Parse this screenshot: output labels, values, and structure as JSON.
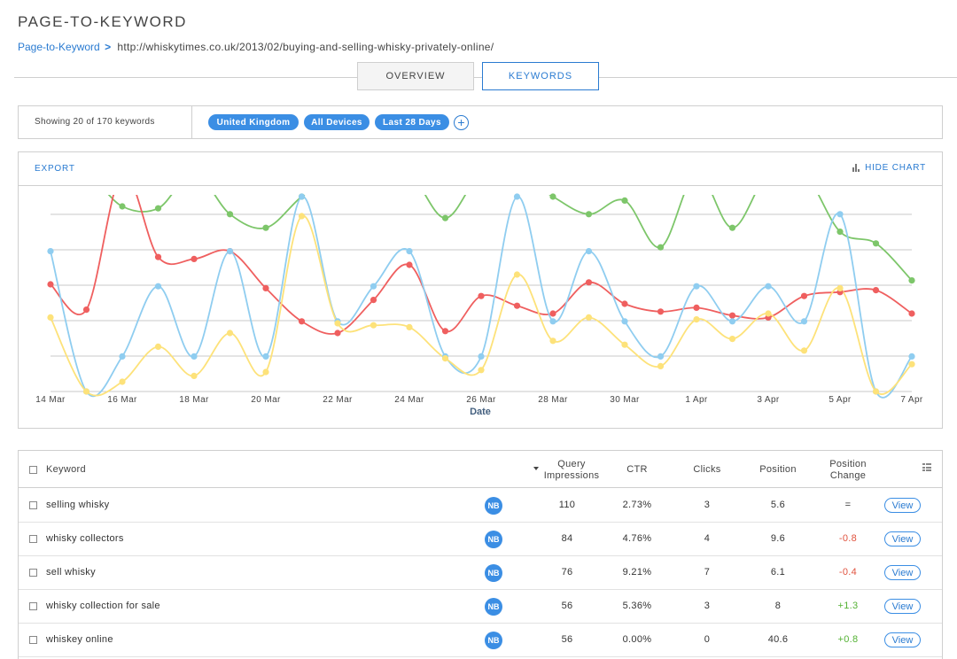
{
  "page": {
    "title": "PAGE-TO-KEYWORD"
  },
  "breadcrumb": {
    "link": "Page-to-Keyword",
    "separator": ">",
    "url": "http://whiskytimes.co.uk/2013/02/buying-and-selling-whisky-privately-online/"
  },
  "tabs": [
    {
      "label": "OVERVIEW",
      "active": false
    },
    {
      "label": "KEYWORDS",
      "active": true
    }
  ],
  "filters": {
    "showing": "Showing 20 of 170 keywords",
    "pills": [
      "United Kingdom",
      "All Devices",
      "Last 28 Days"
    ],
    "add": "+"
  },
  "chart_toolbar": {
    "export": "EXPORT",
    "hide_chart": "HIDE CHART",
    "hide_chart_icon": "bar-chart-icon"
  },
  "chart_data": {
    "type": "line",
    "xlabel": "Date",
    "x_ticks": [
      "14 Mar",
      "16 Mar",
      "18 Mar",
      "20 Mar",
      "22 Mar",
      "24 Mar",
      "26 Mar",
      "28 Mar",
      "30 Mar",
      "1 Apr",
      "3 Apr",
      "5 Apr",
      "7 Apr"
    ],
    "x": [
      "14 Mar",
      "15 Mar",
      "16 Mar",
      "17 Mar",
      "18 Mar",
      "19 Mar",
      "20 Mar",
      "21 Mar",
      "22 Mar",
      "23 Mar",
      "24 Mar",
      "25 Mar",
      "26 Mar",
      "27 Mar",
      "28 Mar",
      "29 Mar",
      "30 Mar",
      "31 Mar",
      "1 Apr",
      "2 Apr",
      "3 Apr",
      "4 Apr",
      "5 Apr",
      "6 Apr",
      "7 Apr"
    ],
    "ylim": [
      0,
      1
    ],
    "grid": true,
    "series": [
      {
        "color": "#7dc66a",
        "values": [
          null,
          null,
          0.95,
          0.94,
          null,
          0.91,
          0.84,
          1.0,
          null,
          null,
          null,
          0.89,
          null,
          null,
          1.0,
          0.91,
          0.98,
          0.74,
          null,
          0.84,
          null,
          null,
          0.82,
          0.76,
          0.57
        ]
      },
      {
        "color": "#ef5f5f",
        "values": [
          0.55,
          0.42,
          null,
          0.69,
          0.68,
          0.72,
          0.53,
          0.36,
          0.3,
          0.47,
          0.65,
          0.31,
          0.49,
          0.44,
          0.4,
          0.56,
          0.45,
          0.41,
          0.43,
          0.39,
          0.38,
          0.49,
          0.51,
          0.52,
          0.4
        ]
      },
      {
        "color": "#8fcdf0",
        "values": [
          0.72,
          0.0,
          0.18,
          0.54,
          0.18,
          0.72,
          0.18,
          1.0,
          0.36,
          0.54,
          0.72,
          0.18,
          0.18,
          1.0,
          0.36,
          0.72,
          0.36,
          0.18,
          0.54,
          0.36,
          0.54,
          0.36,
          0.91,
          0.0,
          0.18
        ]
      },
      {
        "color": "#fde27a",
        "values": [
          0.38,
          0.0,
          0.05,
          0.23,
          0.08,
          0.3,
          0.1,
          0.9,
          0.35,
          0.34,
          0.33,
          0.17,
          0.11,
          0.6,
          0.26,
          0.38,
          0.24,
          0.13,
          0.37,
          0.27,
          0.4,
          0.21,
          0.53,
          0.0,
          0.14
        ]
      }
    ]
  },
  "table": {
    "headers": {
      "keyword": "Keyword",
      "impressions_line1": "Query",
      "impressions_line2": "Impressions",
      "ctr": "CTR",
      "clicks": "Clicks",
      "position": "Position",
      "change_line1": "Position",
      "change_line2": "Change"
    },
    "badge": "NB",
    "view_label": "View",
    "rows": [
      {
        "keyword": "selling whisky",
        "impressions": "110",
        "ctr": "2.73%",
        "clicks": "3",
        "position": "5.6",
        "change": "=",
        "change_color": "#333333"
      },
      {
        "keyword": "whisky collectors",
        "impressions": "84",
        "ctr": "4.76%",
        "clicks": "4",
        "position": "9.6",
        "change": "-0.8",
        "change_color": "#e0533f"
      },
      {
        "keyword": "sell whisky",
        "impressions": "76",
        "ctr": "9.21%",
        "clicks": "7",
        "position": "6.1",
        "change": "-0.4",
        "change_color": "#e0533f"
      },
      {
        "keyword": "whisky collection for sale",
        "impressions": "56",
        "ctr": "5.36%",
        "clicks": "3",
        "position": "8",
        "change": "+1.3",
        "change_color": "#54b234"
      },
      {
        "keyword": "whiskey online",
        "impressions": "56",
        "ctr": "0.00%",
        "clicks": "0",
        "position": "40.6",
        "change": "+0.8",
        "change_color": "#54b234"
      }
    ]
  }
}
